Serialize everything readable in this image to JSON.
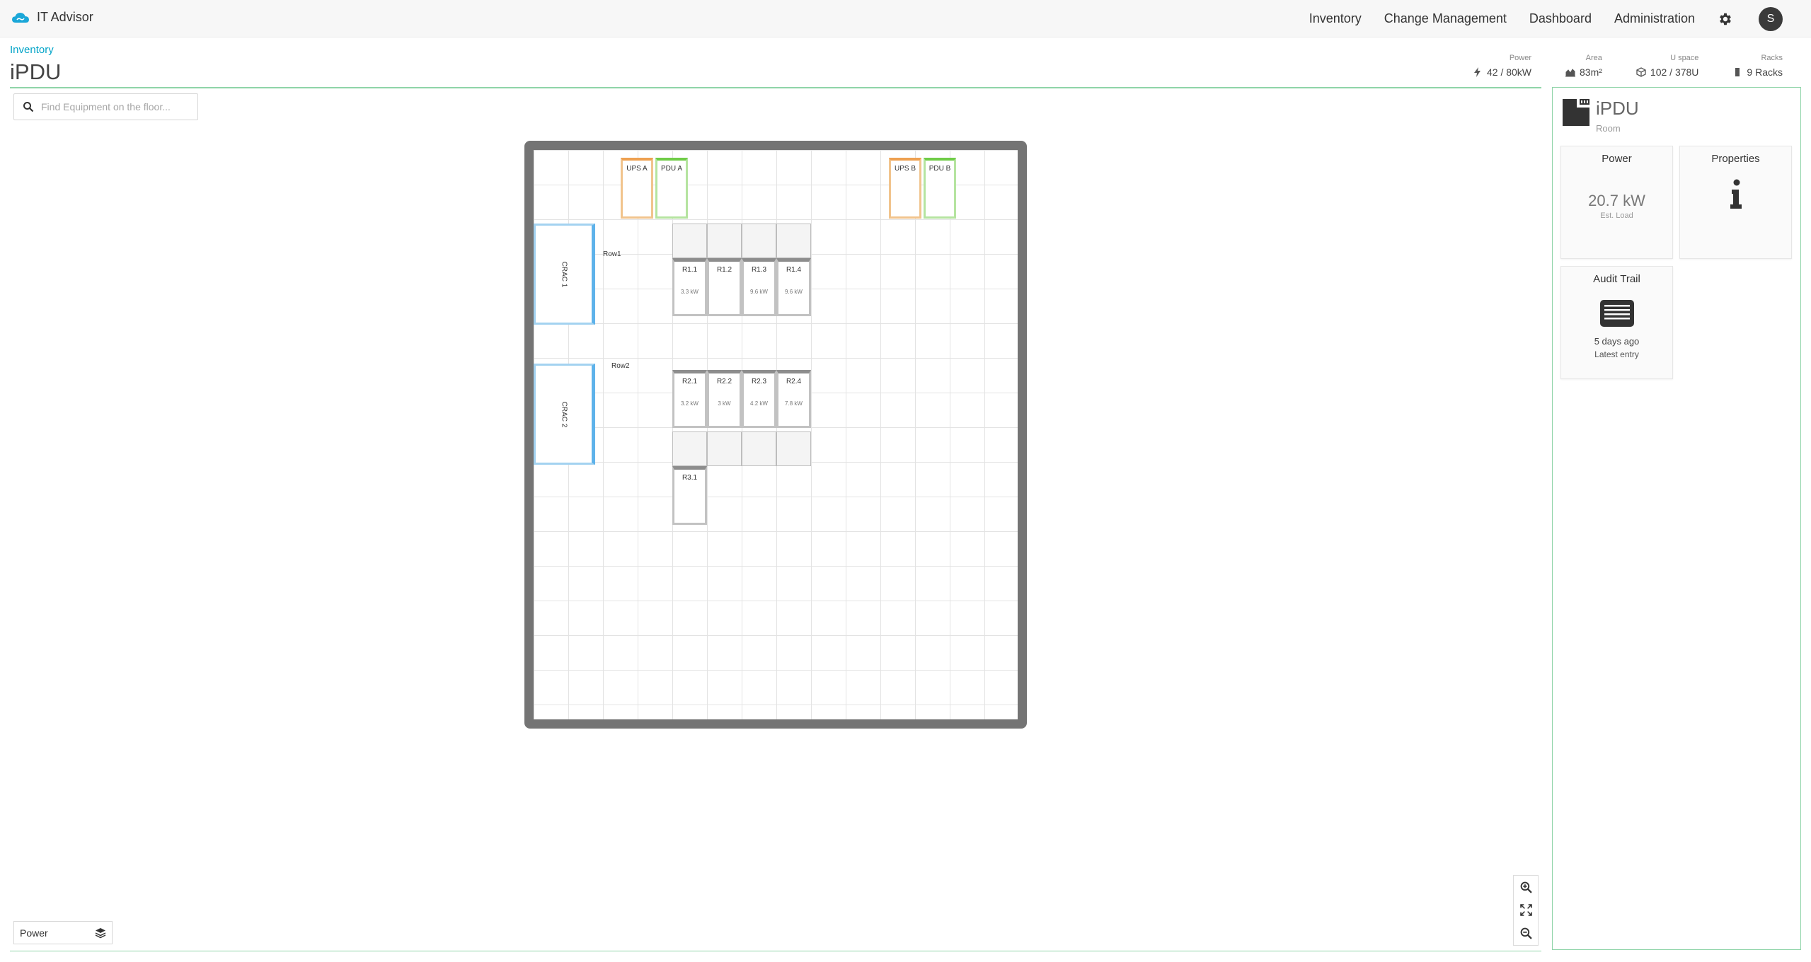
{
  "app": {
    "title": "IT Advisor"
  },
  "nav": {
    "items": [
      "Inventory",
      "Change Management",
      "Dashboard",
      "Administration"
    ],
    "user_initial": "S"
  },
  "breadcrumb": "Inventory",
  "page_title": "iPDU",
  "stats": {
    "power": {
      "label": "Power",
      "value": "42 / 80kW"
    },
    "area": {
      "label": "Area",
      "value": "83m²"
    },
    "uspace": {
      "label": "U space",
      "value": "102 / 378U"
    },
    "racks": {
      "label": "Racks",
      "value": "9 Racks"
    }
  },
  "search": {
    "placeholder": "Find Equipment on the floor..."
  },
  "floor": {
    "ups": [
      "UPS A",
      "UPS B"
    ],
    "pdus": [
      "PDU A",
      "PDU B"
    ],
    "cracs": [
      "CRAC 1",
      "CRAC 2"
    ],
    "row_labels": [
      "Row1",
      "Row2"
    ],
    "racks": [
      {
        "id": "R1.1",
        "power": "3.3 kW"
      },
      {
        "id": "R1.2",
        "power": ""
      },
      {
        "id": "R1.3",
        "power": "9.6 kW"
      },
      {
        "id": "R1.4",
        "power": "9.6 kW"
      },
      {
        "id": "R2.1",
        "power": "3.2 kW"
      },
      {
        "id": "R2.2",
        "power": "3 kW"
      },
      {
        "id": "R2.3",
        "power": "4.2 kW"
      },
      {
        "id": "R2.4",
        "power": "7.8 kW"
      },
      {
        "id": "R3.1",
        "power": ""
      }
    ]
  },
  "layer_select": {
    "value": "Power"
  },
  "panel": {
    "title": "iPDU",
    "subtitle": "Room",
    "power_card": {
      "title": "Power",
      "value": "20.7 kW",
      "caption": "Est. Load"
    },
    "properties_card": {
      "title": "Properties"
    },
    "audit_card": {
      "title": "Audit Trail",
      "value": "5 days ago",
      "caption": "Latest entry"
    }
  },
  "colors": {
    "accent": "#00a3c7",
    "ups": "#eea050",
    "pdu": "#6fcc47",
    "crac": "#5eb2ea",
    "rack": "#8d8d8d"
  }
}
